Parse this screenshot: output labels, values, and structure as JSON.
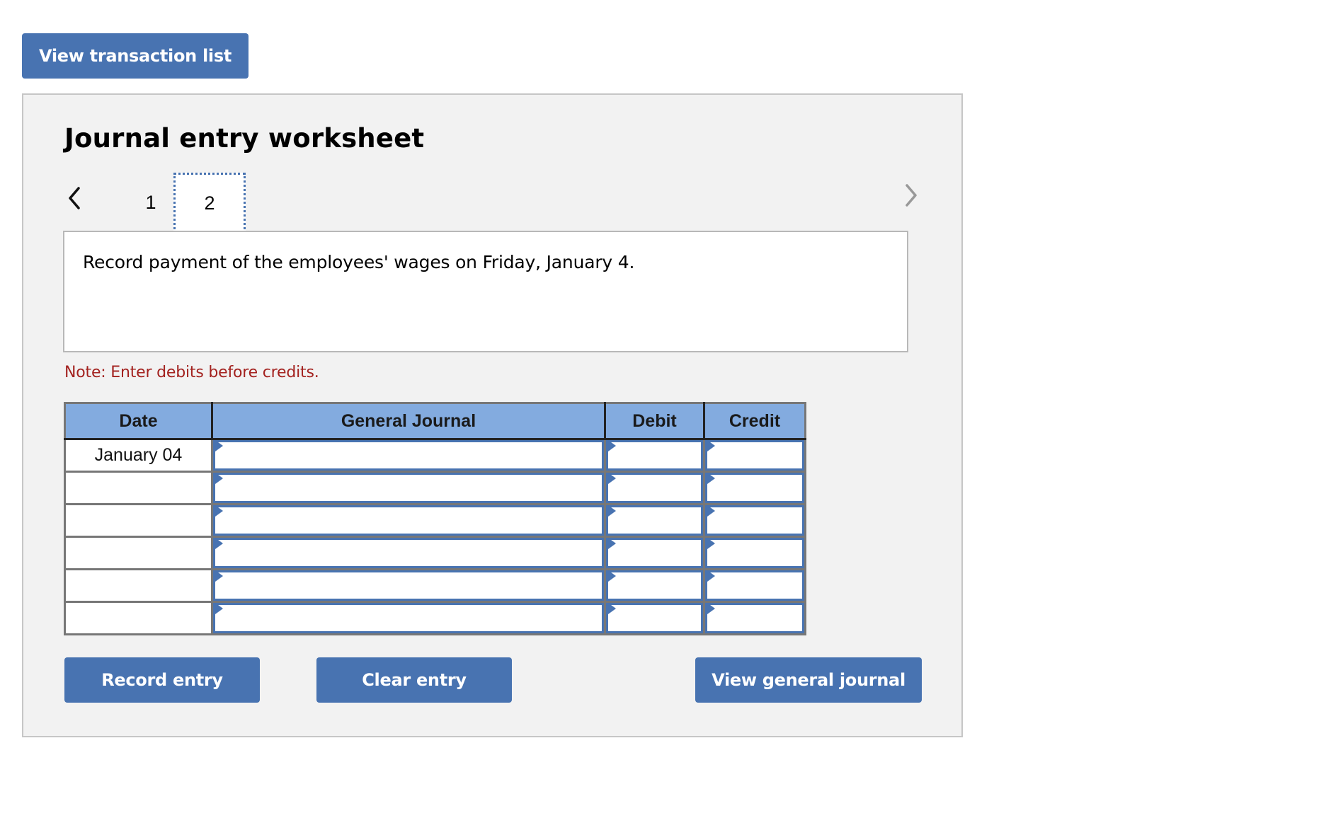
{
  "top_button": {
    "label": "View transaction list"
  },
  "worksheet": {
    "title": "Journal entry worksheet",
    "nav": {
      "prev_icon": "chevron-left-icon",
      "next_icon": "chevron-right-icon",
      "tabs": [
        {
          "label": "1",
          "active": false
        },
        {
          "label": "2",
          "active": true
        }
      ]
    },
    "instruction": "Record payment of the employees' wages on Friday, January 4.",
    "note": "Note: Enter debits before credits.",
    "table": {
      "headers": [
        "Date",
        "General Journal",
        "Debit",
        "Credit"
      ],
      "rows": [
        {
          "date": "January 04",
          "account": "",
          "debit": "",
          "credit": ""
        },
        {
          "date": "",
          "account": "",
          "debit": "",
          "credit": ""
        },
        {
          "date": "",
          "account": "",
          "debit": "",
          "credit": ""
        },
        {
          "date": "",
          "account": "",
          "debit": "",
          "credit": ""
        },
        {
          "date": "",
          "account": "",
          "debit": "",
          "credit": ""
        },
        {
          "date": "",
          "account": "",
          "debit": "",
          "credit": ""
        }
      ]
    },
    "buttons": {
      "record": "Record entry",
      "clear": "Clear entry",
      "view_general_journal": "View general journal"
    }
  },
  "colors": {
    "button_blue": "#4873b1",
    "header_blue": "#83abdf",
    "note_red": "#a3221f",
    "panel_bg": "#f2f2f2"
  }
}
